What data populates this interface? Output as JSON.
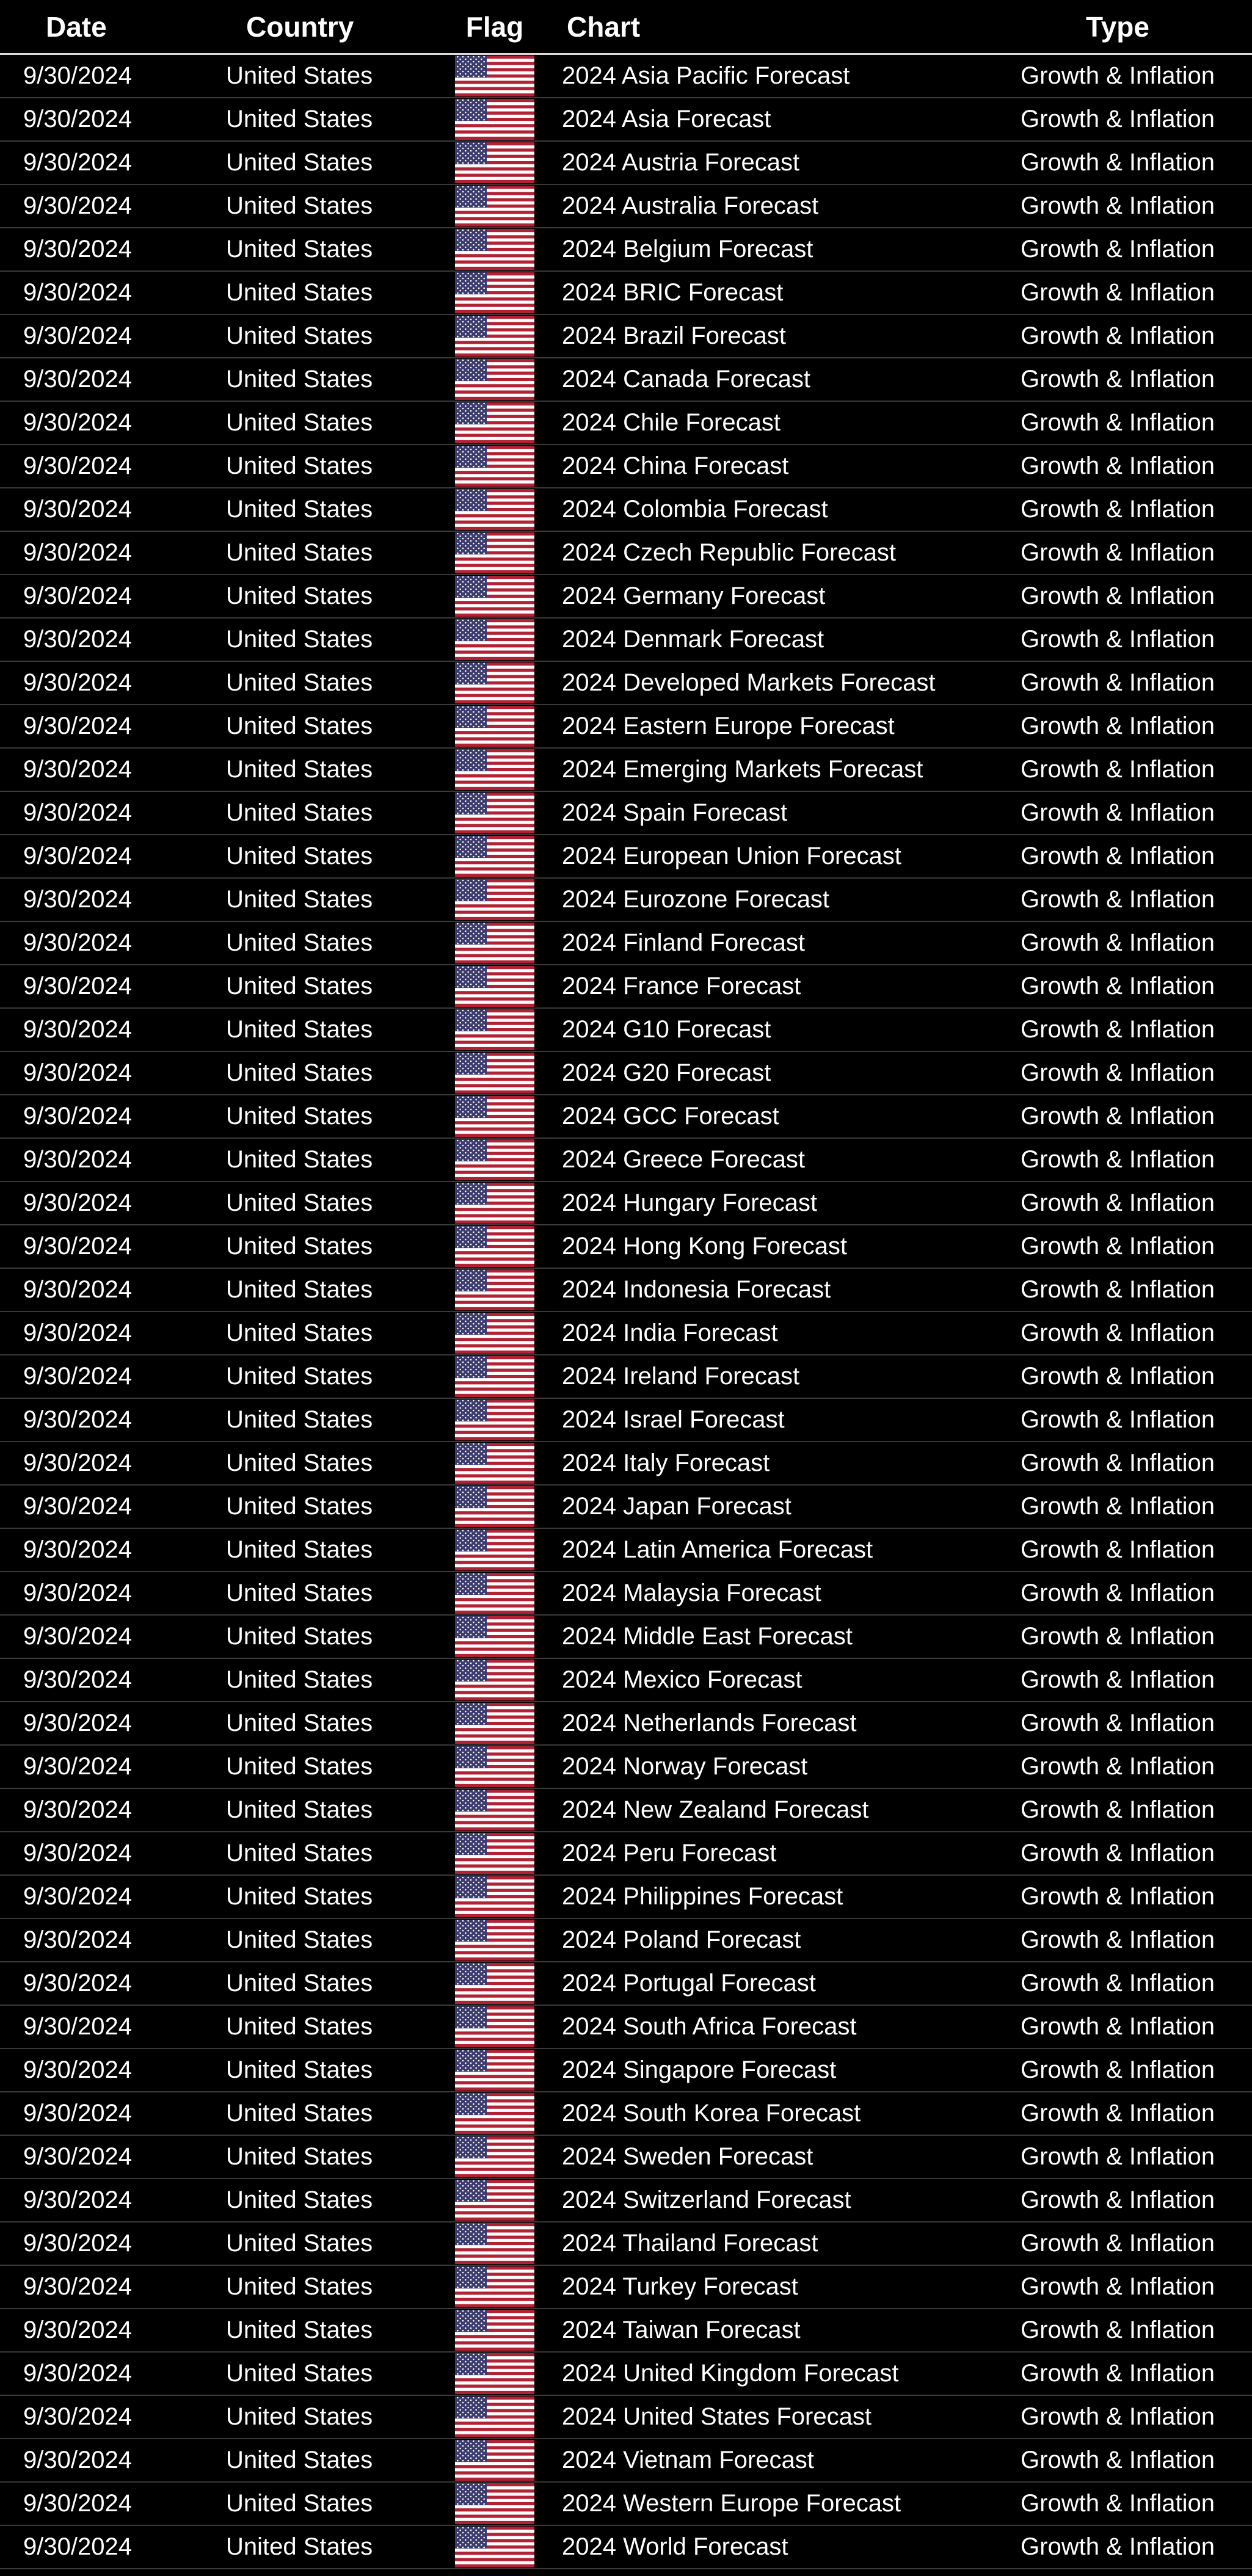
{
  "table": {
    "headers": {
      "date": "Date",
      "country": "Country",
      "flag": "Flag",
      "chart": "Chart",
      "type": "Type"
    },
    "rows": [
      {
        "date": "9/30/2024",
        "country": "United States",
        "flag": "us-flag-icon",
        "chart": "2024 Asia Pacific Forecast",
        "type": "Growth & Inflation"
      },
      {
        "date": "9/30/2024",
        "country": "United States",
        "flag": "us-flag-icon",
        "chart": "2024 Asia Forecast",
        "type": "Growth & Inflation"
      },
      {
        "date": "9/30/2024",
        "country": "United States",
        "flag": "us-flag-icon",
        "chart": "2024 Austria Forecast",
        "type": "Growth & Inflation"
      },
      {
        "date": "9/30/2024",
        "country": "United States",
        "flag": "us-flag-icon",
        "chart": "2024 Australia Forecast",
        "type": "Growth & Inflation"
      },
      {
        "date": "9/30/2024",
        "country": "United States",
        "flag": "us-flag-icon",
        "chart": "2024 Belgium Forecast",
        "type": "Growth & Inflation"
      },
      {
        "date": "9/30/2024",
        "country": "United States",
        "flag": "us-flag-icon",
        "chart": "2024 BRIC Forecast",
        "type": "Growth & Inflation"
      },
      {
        "date": "9/30/2024",
        "country": "United States",
        "flag": "us-flag-icon",
        "chart": "2024 Brazil Forecast",
        "type": "Growth & Inflation"
      },
      {
        "date": "9/30/2024",
        "country": "United States",
        "flag": "us-flag-icon",
        "chart": "2024 Canada Forecast",
        "type": "Growth & Inflation"
      },
      {
        "date": "9/30/2024",
        "country": "United States",
        "flag": "us-flag-icon",
        "chart": "2024 Chile Forecast",
        "type": "Growth & Inflation"
      },
      {
        "date": "9/30/2024",
        "country": "United States",
        "flag": "us-flag-icon",
        "chart": "2024 China Forecast",
        "type": "Growth & Inflation"
      },
      {
        "date": "9/30/2024",
        "country": "United States",
        "flag": "us-flag-icon",
        "chart": "2024 Colombia Forecast",
        "type": "Growth & Inflation"
      },
      {
        "date": "9/30/2024",
        "country": "United States",
        "flag": "us-flag-icon",
        "chart": "2024 Czech Republic Forecast",
        "type": "Growth & Inflation"
      },
      {
        "date": "9/30/2024",
        "country": "United States",
        "flag": "us-flag-icon",
        "chart": "2024 Germany Forecast",
        "type": "Growth & Inflation"
      },
      {
        "date": "9/30/2024",
        "country": "United States",
        "flag": "us-flag-icon",
        "chart": "2024 Denmark Forecast",
        "type": "Growth & Inflation"
      },
      {
        "date": "9/30/2024",
        "country": "United States",
        "flag": "us-flag-icon",
        "chart": "2024 Developed Markets Forecast",
        "type": "Growth & Inflation"
      },
      {
        "date": "9/30/2024",
        "country": "United States",
        "flag": "us-flag-icon",
        "chart": "2024 Eastern Europe Forecast",
        "type": "Growth & Inflation"
      },
      {
        "date": "9/30/2024",
        "country": "United States",
        "flag": "us-flag-icon",
        "chart": "2024 Emerging Markets Forecast",
        "type": "Growth & Inflation"
      },
      {
        "date": "9/30/2024",
        "country": "United States",
        "flag": "us-flag-icon",
        "chart": "2024 Spain Forecast",
        "type": "Growth & Inflation"
      },
      {
        "date": "9/30/2024",
        "country": "United States",
        "flag": "us-flag-icon",
        "chart": "2024 European Union Forecast",
        "type": "Growth & Inflation"
      },
      {
        "date": "9/30/2024",
        "country": "United States",
        "flag": "us-flag-icon",
        "chart": "2024 Eurozone Forecast",
        "type": "Growth & Inflation"
      },
      {
        "date": "9/30/2024",
        "country": "United States",
        "flag": "us-flag-icon",
        "chart": "2024 Finland Forecast",
        "type": "Growth & Inflation"
      },
      {
        "date": "9/30/2024",
        "country": "United States",
        "flag": "us-flag-icon",
        "chart": "2024 France Forecast",
        "type": "Growth & Inflation"
      },
      {
        "date": "9/30/2024",
        "country": "United States",
        "flag": "us-flag-icon",
        "chart": "2024 G10 Forecast",
        "type": "Growth & Inflation"
      },
      {
        "date": "9/30/2024",
        "country": "United States",
        "flag": "us-flag-icon",
        "chart": "2024 G20 Forecast",
        "type": "Growth & Inflation"
      },
      {
        "date": "9/30/2024",
        "country": "United States",
        "flag": "us-flag-icon",
        "chart": "2024 GCC Forecast",
        "type": "Growth & Inflation"
      },
      {
        "date": "9/30/2024",
        "country": "United States",
        "flag": "us-flag-icon",
        "chart": "2024 Greece Forecast",
        "type": "Growth & Inflation"
      },
      {
        "date": "9/30/2024",
        "country": "United States",
        "flag": "us-flag-icon",
        "chart": "2024 Hungary Forecast",
        "type": "Growth & Inflation"
      },
      {
        "date": "9/30/2024",
        "country": "United States",
        "flag": "us-flag-icon",
        "chart": "2024 Hong Kong Forecast",
        "type": "Growth & Inflation"
      },
      {
        "date": "9/30/2024",
        "country": "United States",
        "flag": "us-flag-icon",
        "chart": "2024 Indonesia Forecast",
        "type": "Growth & Inflation"
      },
      {
        "date": "9/30/2024",
        "country": "United States",
        "flag": "us-flag-icon",
        "chart": "2024 India Forecast",
        "type": "Growth & Inflation"
      },
      {
        "date": "9/30/2024",
        "country": "United States",
        "flag": "us-flag-icon",
        "chart": "2024 Ireland Forecast",
        "type": "Growth & Inflation"
      },
      {
        "date": "9/30/2024",
        "country": "United States",
        "flag": "us-flag-icon",
        "chart": "2024 Israel Forecast",
        "type": "Growth & Inflation"
      },
      {
        "date": "9/30/2024",
        "country": "United States",
        "flag": "us-flag-icon",
        "chart": "2024 Italy Forecast",
        "type": "Growth & Inflation"
      },
      {
        "date": "9/30/2024",
        "country": "United States",
        "flag": "us-flag-icon",
        "chart": "2024 Japan Forecast",
        "type": "Growth & Inflation"
      },
      {
        "date": "9/30/2024",
        "country": "United States",
        "flag": "us-flag-icon",
        "chart": "2024 Latin America Forecast",
        "type": "Growth & Inflation"
      },
      {
        "date": "9/30/2024",
        "country": "United States",
        "flag": "us-flag-icon",
        "chart": "2024 Malaysia Forecast",
        "type": "Growth & Inflation"
      },
      {
        "date": "9/30/2024",
        "country": "United States",
        "flag": "us-flag-icon",
        "chart": "2024 Middle East Forecast",
        "type": "Growth & Inflation"
      },
      {
        "date": "9/30/2024",
        "country": "United States",
        "flag": "us-flag-icon",
        "chart": "2024 Mexico Forecast",
        "type": "Growth & Inflation"
      },
      {
        "date": "9/30/2024",
        "country": "United States",
        "flag": "us-flag-icon",
        "chart": "2024 Netherlands Forecast",
        "type": "Growth & Inflation"
      },
      {
        "date": "9/30/2024",
        "country": "United States",
        "flag": "us-flag-icon",
        "chart": "2024 Norway Forecast",
        "type": "Growth & Inflation"
      },
      {
        "date": "9/30/2024",
        "country": "United States",
        "flag": "us-flag-icon",
        "chart": "2024 New Zealand Forecast",
        "type": "Growth & Inflation"
      },
      {
        "date": "9/30/2024",
        "country": "United States",
        "flag": "us-flag-icon",
        "chart": "2024 Peru Forecast",
        "type": "Growth & Inflation"
      },
      {
        "date": "9/30/2024",
        "country": "United States",
        "flag": "us-flag-icon",
        "chart": "2024 Philippines Forecast",
        "type": "Growth & Inflation"
      },
      {
        "date": "9/30/2024",
        "country": "United States",
        "flag": "us-flag-icon",
        "chart": "2024 Poland Forecast",
        "type": "Growth & Inflation"
      },
      {
        "date": "9/30/2024",
        "country": "United States",
        "flag": "us-flag-icon",
        "chart": "2024 Portugal Forecast",
        "type": "Growth & Inflation"
      },
      {
        "date": "9/30/2024",
        "country": "United States",
        "flag": "us-flag-icon",
        "chart": "2024 South Africa Forecast",
        "type": "Growth & Inflation"
      },
      {
        "date": "9/30/2024",
        "country": "United States",
        "flag": "us-flag-icon",
        "chart": "2024 Singapore Forecast",
        "type": "Growth & Inflation"
      },
      {
        "date": "9/30/2024",
        "country": "United States",
        "flag": "us-flag-icon",
        "chart": "2024 South Korea Forecast",
        "type": "Growth & Inflation"
      },
      {
        "date": "9/30/2024",
        "country": "United States",
        "flag": "us-flag-icon",
        "chart": "2024 Sweden Forecast",
        "type": "Growth & Inflation"
      },
      {
        "date": "9/30/2024",
        "country": "United States",
        "flag": "us-flag-icon",
        "chart": "2024 Switzerland Forecast",
        "type": "Growth & Inflation"
      },
      {
        "date": "9/30/2024",
        "country": "United States",
        "flag": "us-flag-icon",
        "chart": "2024 Thailand Forecast",
        "type": "Growth & Inflation"
      },
      {
        "date": "9/30/2024",
        "country": "United States",
        "flag": "us-flag-icon",
        "chart": "2024 Turkey Forecast",
        "type": "Growth & Inflation"
      },
      {
        "date": "9/30/2024",
        "country": "United States",
        "flag": "us-flag-icon",
        "chart": "2024 Taiwan Forecast",
        "type": "Growth & Inflation"
      },
      {
        "date": "9/30/2024",
        "country": "United States",
        "flag": "us-flag-icon",
        "chart": "2024 United Kingdom Forecast",
        "type": "Growth & Inflation"
      },
      {
        "date": "9/30/2024",
        "country": "United States",
        "flag": "us-flag-icon",
        "chart": "2024 United States Forecast",
        "type": "Growth & Inflation"
      },
      {
        "date": "9/30/2024",
        "country": "United States",
        "flag": "us-flag-icon",
        "chart": "2024 Vietnam Forecast",
        "type": "Growth & Inflation"
      },
      {
        "date": "9/30/2024",
        "country": "United States",
        "flag": "us-flag-icon",
        "chart": "2024 Western Europe Forecast",
        "type": "Growth & Inflation"
      },
      {
        "date": "9/30/2024",
        "country": "United States",
        "flag": "us-flag-icon",
        "chart": "2024 World Forecast",
        "type": "Growth & Inflation"
      }
    ]
  },
  "colors": {
    "background": "#000000",
    "text": "#ffffff",
    "row_divider": "#3a3a3a",
    "flag_red": "#b22234",
    "flag_white": "#ffffff",
    "flag_blue": "#3c3b6e"
  }
}
